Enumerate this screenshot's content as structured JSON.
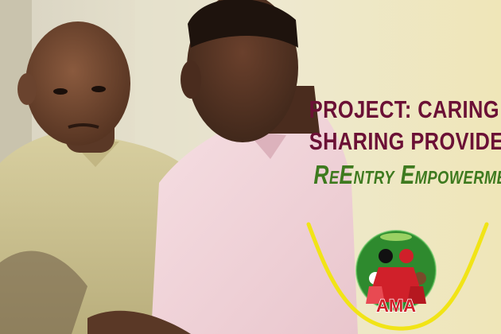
{
  "headline": {
    "line1": "PROJECT: CARING AND",
    "line2": "SHARING  PROVIDES:",
    "line3": "ReEntry Empowerment"
  },
  "logo": {
    "text": "AMA",
    "icon": "family-circle-logo-icon"
  },
  "colors": {
    "background": "#efe6b8",
    "headline": "#6b1035",
    "subheadline": "#3e7a1f",
    "arc": "#f1e416",
    "logo_circle": "#2e8a2e",
    "logo_red": "#d0202a"
  }
}
